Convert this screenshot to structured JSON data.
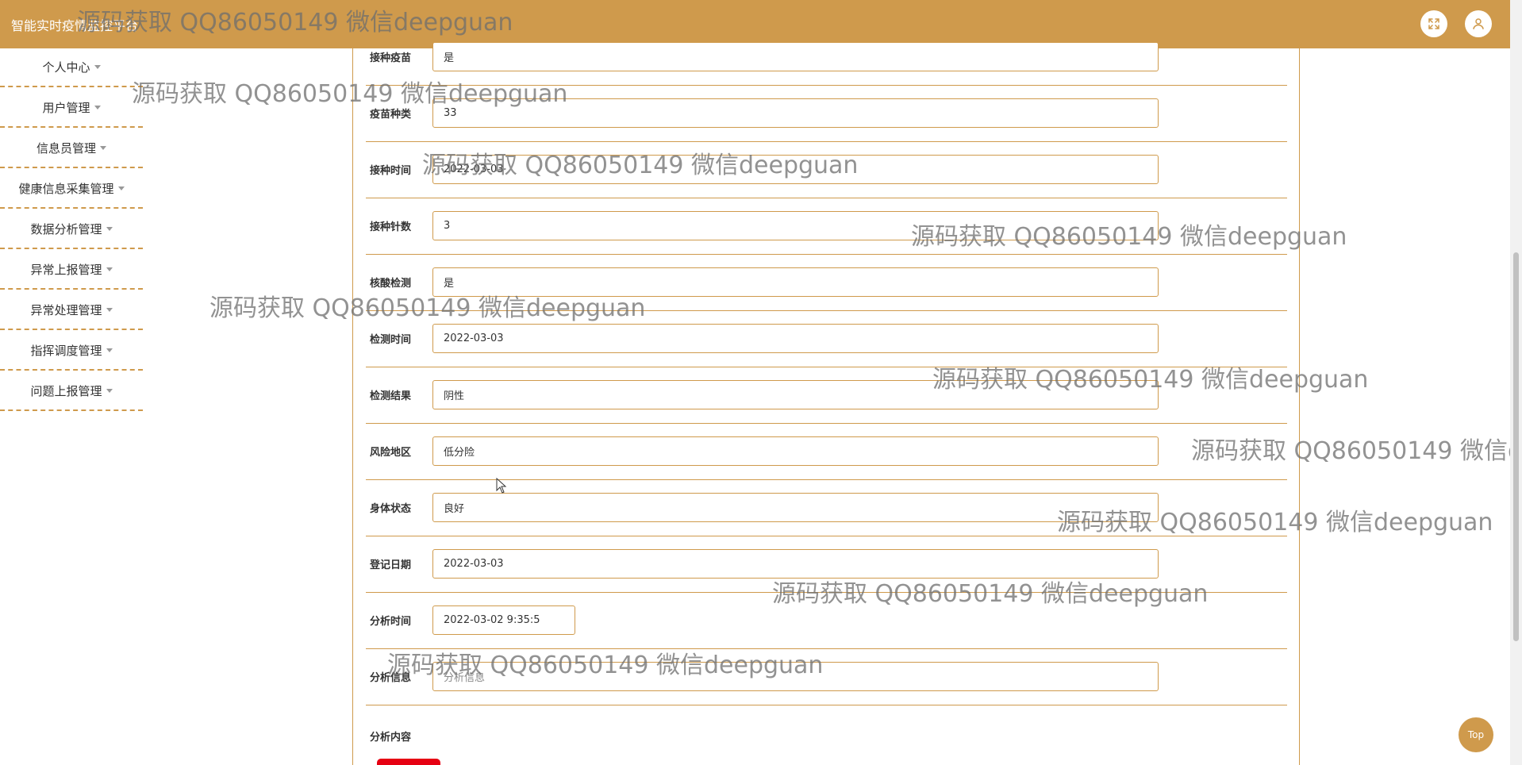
{
  "header": {
    "title": "智能实时疫情监控平台",
    "fullscreen_icon": "expand-icon",
    "user_icon": "user-icon"
  },
  "sidebar": {
    "items": [
      {
        "label": "个人中心"
      },
      {
        "label": "用户管理"
      },
      {
        "label": "信息员管理"
      },
      {
        "label": "健康信息采集管理"
      },
      {
        "label": "数据分析管理"
      },
      {
        "label": "异常上报管理"
      },
      {
        "label": "异常处理管理"
      },
      {
        "label": "指挥调度管理"
      },
      {
        "label": "问题上报管理"
      }
    ]
  },
  "form": {
    "rows": [
      {
        "label": "接种疫苗",
        "value": "是"
      },
      {
        "label": "疫苗种类",
        "value": "33"
      },
      {
        "label": "接种时间",
        "value": "2022-03-03"
      },
      {
        "label": "接种针数",
        "value": "3"
      },
      {
        "label": "核酸检测",
        "value": "是"
      },
      {
        "label": "检测时间",
        "value": "2022-03-03"
      },
      {
        "label": "检测结果",
        "value": "阴性"
      },
      {
        "label": "风险地区",
        "value": "低分险"
      },
      {
        "label": "身体状态",
        "value": "良好"
      },
      {
        "label": "登记日期",
        "value": "2022-03-03"
      },
      {
        "label": "分析时间",
        "value": "2022-03-02 9:35:5"
      },
      {
        "label": "分析信息",
        "placeholder": "分析信息"
      }
    ],
    "content_label": "分析内容"
  },
  "top_button": {
    "label": "Top"
  },
  "watermark": {
    "text": "源码获取 QQ86050149 微信deepguan"
  },
  "colors": {
    "accent": "#cf9a4c",
    "danger": "#e60012"
  }
}
